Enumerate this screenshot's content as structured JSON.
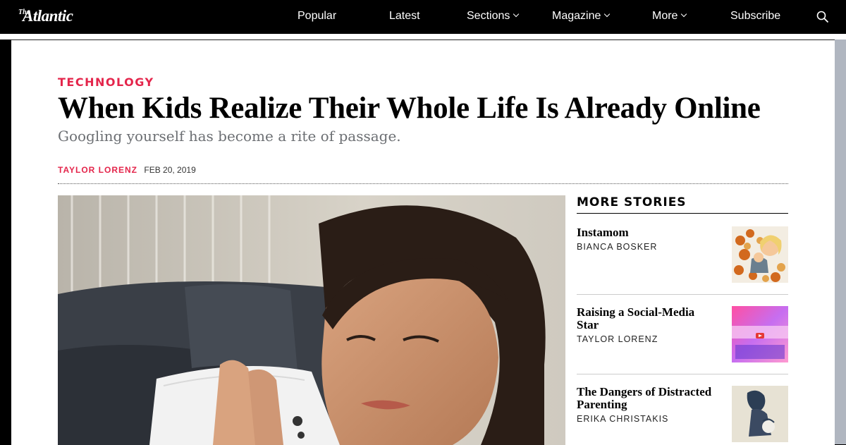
{
  "header": {
    "logo_the": "The",
    "logo_name": "Atlantic",
    "nav": {
      "popular": "Popular",
      "latest": "Latest",
      "sections": "Sections",
      "magazine": "Magazine",
      "more": "More",
      "subscribe": "Subscribe"
    }
  },
  "article": {
    "section": "TECHNOLOGY",
    "title": "When Kids Realize Their Whole Life Is Already Online",
    "dek": "Googling yourself has become a rite of passage.",
    "author": "TAYLOR LORENZ",
    "date": "FEB 20, 2019"
  },
  "more_stories": {
    "heading": "MORE STORIES",
    "items": [
      {
        "title": "Instamom",
        "author": "BIANCA BOSKER"
      },
      {
        "title": "Raising a Social-Media Star",
        "author": "TAYLOR LORENZ"
      },
      {
        "title": "The Dangers of Distracted Parenting",
        "author": "ERIKA CHRISTAKIS"
      }
    ]
  },
  "colors": {
    "accent": "#e4254b",
    "nav_bg": "#000000"
  }
}
